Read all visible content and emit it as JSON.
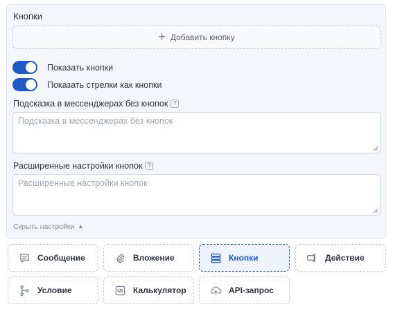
{
  "panel": {
    "title": "Кнопки",
    "add_button": "Добавить кнопку",
    "toggles": [
      {
        "label": "Показать кнопки",
        "on": true
      },
      {
        "label": "Показать стрелки как кнопки",
        "on": true
      }
    ],
    "hint_field": {
      "label": "Подсказка в мессенджерах без кнопок",
      "placeholder": "Подсказка в мессенджерах без кнопок",
      "help": "?"
    },
    "advanced_field": {
      "label": "Расширенные настройки кнопок",
      "placeholder": "Расширенные настройки кнопок",
      "help": "?"
    },
    "hide_settings": "Скрыть настройки"
  },
  "blocks": [
    {
      "label": "Сообщение",
      "icon": "message-icon",
      "active": false
    },
    {
      "label": "Вложение",
      "icon": "paperclip-icon",
      "active": false
    },
    {
      "label": "Кнопки",
      "icon": "buttons-icon",
      "active": true
    },
    {
      "label": "Действие",
      "icon": "action-icon",
      "active": false
    },
    {
      "label": "Условие",
      "icon": "branch-icon",
      "active": false
    },
    {
      "label": "Калькулятор",
      "icon": "code-icon",
      "active": false
    },
    {
      "label": "API-запрос",
      "icon": "cloud-upload-icon",
      "active": false
    }
  ],
  "colors": {
    "accent": "#2159c9",
    "panel_bg": "#f3f6fa"
  }
}
